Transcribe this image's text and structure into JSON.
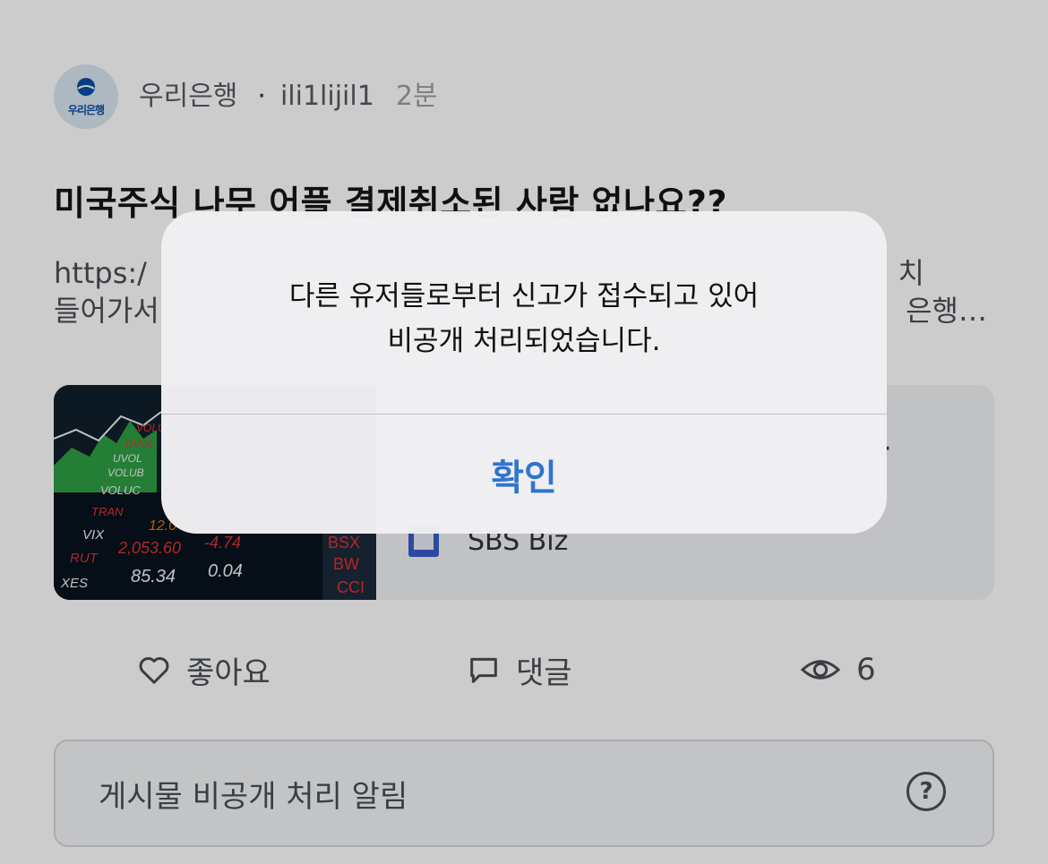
{
  "post": {
    "avatar_text": "우리은행",
    "author": "우리은행",
    "separator": "·",
    "username": "ili1lijil1",
    "time": "2분",
    "title": "미국주식 나무 어플 결제취소된 사람 없나요??",
    "body_line1_start": "https:/",
    "body_line1_end": "치",
    "body_line2_start": "들어가서",
    "body_line2_end": "은행…"
  },
  "link_card": {
    "ellipsis": "·",
    "source": "SBS Biz",
    "thumbnail_tickers": [
      "VOLU",
      "DVOL",
      "UVOL",
      "VOLUB",
      "VOLUC",
      "TRAN",
      "VIX",
      "RUT",
      "XES",
      "BSX",
      "BW",
      "CCI"
    ],
    "thumbnail_values": [
      "2,053.60",
      "-4.74",
      "85.34",
      "0.04",
      "12.0"
    ]
  },
  "actions": {
    "like_label": "좋아요",
    "comment_label": "댓글",
    "view_count": "6"
  },
  "notice": {
    "label": "게시물 비공개 처리 알림",
    "help_symbol": "?"
  },
  "alert": {
    "message_line1": "다른 유저들로부터 신고가 접수되고 있어",
    "message_line2": "비공개 처리되었습니다.",
    "confirm_label": "확인"
  },
  "colors": {
    "accent": "#2f74d0",
    "overlay": "rgba(0,0,0,0.20)"
  }
}
